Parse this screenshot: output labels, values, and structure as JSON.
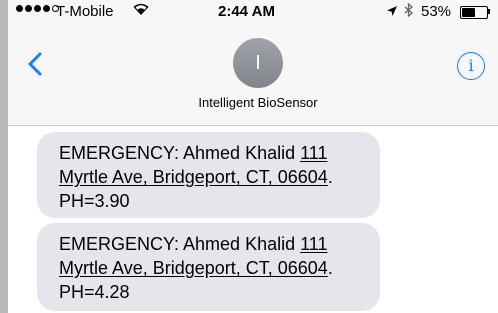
{
  "status_bar": {
    "carrier": "T-Mobile",
    "time": "2:44 AM",
    "battery": "53%",
    "battery_level": 0.53,
    "signal_bars_filled": 4,
    "signal_bars_total": 5
  },
  "nav": {
    "back_icon": "chevron-left-icon",
    "avatar_initial": "I",
    "contact_name": "Intelligent BioSensor",
    "info_icon": "info-icon",
    "info_glyph": "i"
  },
  "messages": [
    {
      "prefix": "EMERGENCY: Ahmed Khalid ",
      "address": "111 Myrtle Ave, Bridgeport, CT, 06604",
      "after_address": ".",
      "reading": "PH=3.90"
    },
    {
      "prefix": "EMERGENCY: Ahmed Khalid ",
      "address": "111 Myrtle Ave, Bridgeport, CT, 06604",
      "after_address": ".",
      "reading": "PH=4.28"
    }
  ],
  "colors": {
    "accent": "#147efb",
    "bubble": "#e6e5eb",
    "nav_background": "#f7f7f7"
  }
}
